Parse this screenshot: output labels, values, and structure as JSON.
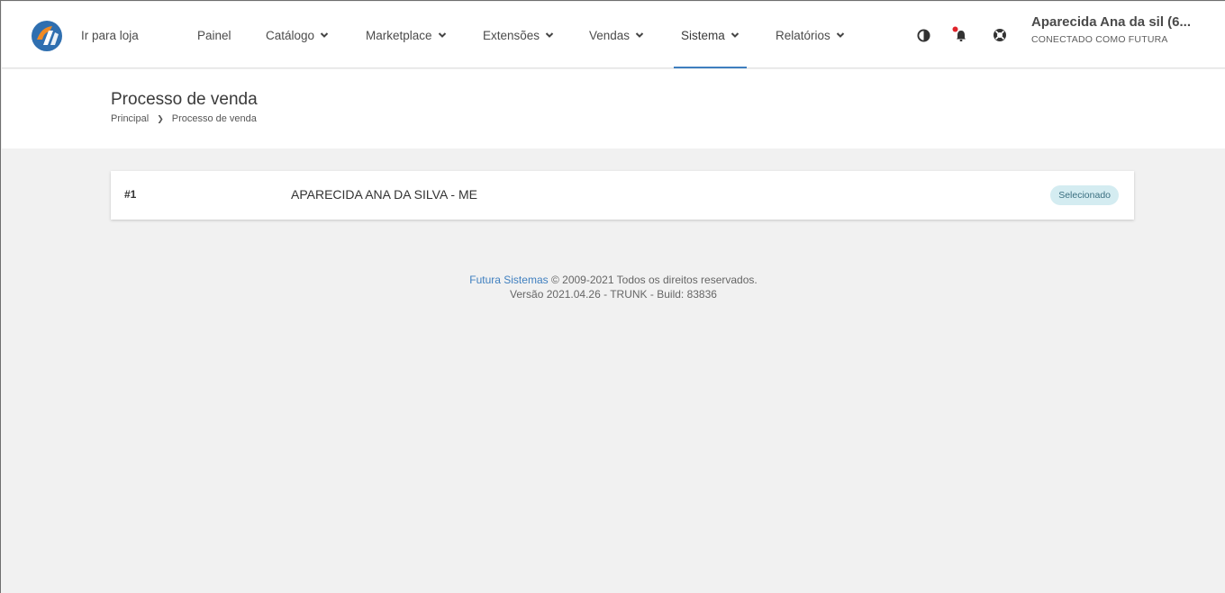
{
  "navbar": {
    "logo_name": "futura-logo",
    "items": [
      {
        "label": "Ir para loja",
        "has_dropdown": false
      },
      {
        "label": "Painel",
        "has_dropdown": false
      },
      {
        "label": "Catálogo",
        "has_dropdown": true
      },
      {
        "label": "Marketplace",
        "has_dropdown": true
      },
      {
        "label": "Extensões",
        "has_dropdown": true
      },
      {
        "label": "Vendas",
        "has_dropdown": true
      },
      {
        "label": "Sistema",
        "has_dropdown": true,
        "active": true
      },
      {
        "label": "Relatórios",
        "has_dropdown": true
      }
    ],
    "icons": [
      "contrast-icon",
      "bell-icon",
      "help-icon"
    ],
    "notification_dot_color": "#e0242b",
    "active_color": "#3f7fbf"
  },
  "user": {
    "name": "Aparecida Ana da sil (6...",
    "subtitle": "CONECTADO COMO FUTURA"
  },
  "page": {
    "title": "Processo de venda",
    "breadcrumb": [
      "Principal",
      "Processo de venda"
    ]
  },
  "card": {
    "number": "#1",
    "name": "APARECIDA ANA DA SILVA - ME",
    "status": "Selecionado",
    "status_color": "#d4ecf1"
  },
  "footer": {
    "company_link": "Futura Sistemas",
    "copyright": "© 2009-2021 Todos os direitos reservados.",
    "version": "Versão 2021.04.26 - TRUNK - Build: 83836"
  }
}
